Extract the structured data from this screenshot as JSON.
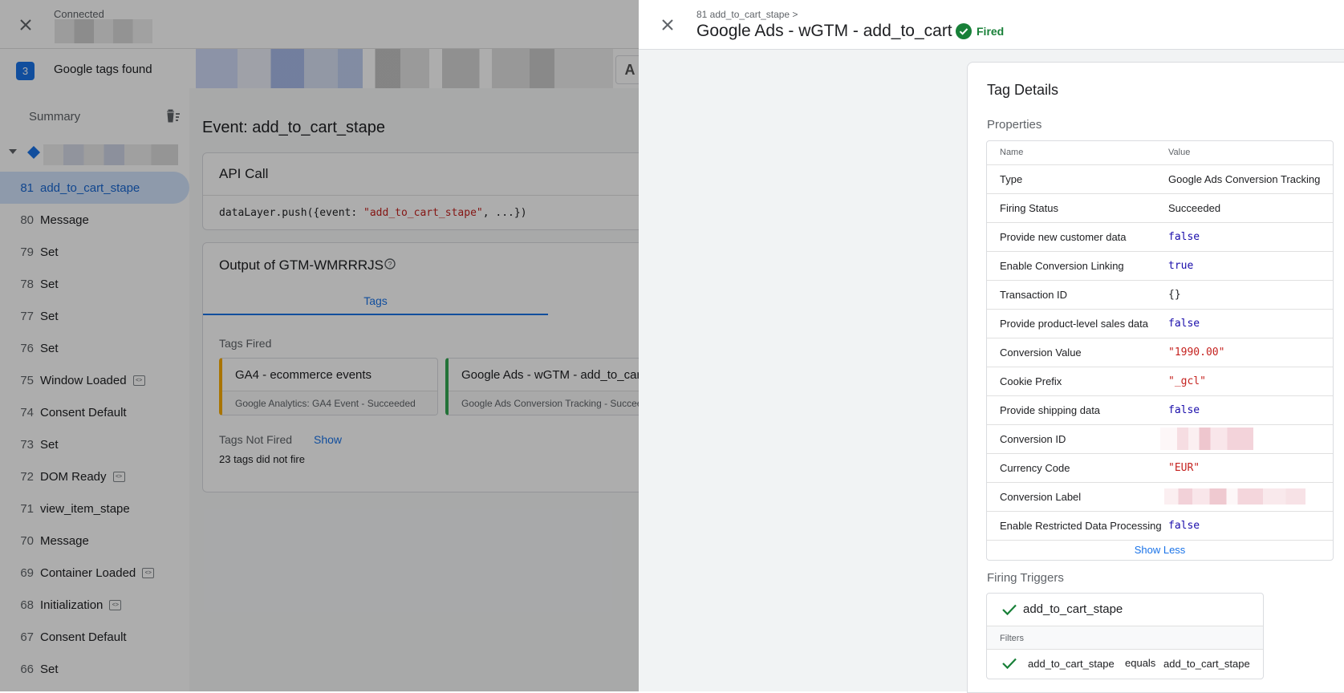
{
  "app": {
    "status": "Connected",
    "tag_count": "3",
    "tags_found": "Google tags found"
  },
  "sidebar": {
    "summary": "Summary",
    "events": [
      {
        "num": "81",
        "label": "add_to_cart_stape"
      },
      {
        "num": "80",
        "label": "Message"
      },
      {
        "num": "79",
        "label": "Set"
      },
      {
        "num": "78",
        "label": "Set"
      },
      {
        "num": "77",
        "label": "Set"
      },
      {
        "num": "76",
        "label": "Set"
      },
      {
        "num": "75",
        "label": "Window Loaded"
      },
      {
        "num": "74",
        "label": "Consent Default"
      },
      {
        "num": "73",
        "label": "Set"
      },
      {
        "num": "72",
        "label": "DOM Ready"
      },
      {
        "num": "71",
        "label": "view_item_stape"
      },
      {
        "num": "70",
        "label": "Message"
      },
      {
        "num": "69",
        "label": "Container Loaded"
      },
      {
        "num": "68",
        "label": "Initialization"
      },
      {
        "num": "67",
        "label": "Consent Default"
      },
      {
        "num": "66",
        "label": "Set"
      }
    ]
  },
  "main": {
    "event_title": "Event: add_to_cart_stape",
    "api_call": {
      "title": "API Call",
      "code_prefix": "dataLayer.push({event: ",
      "code_event": "\"add_to_cart_stape\"",
      "code_suffix": ", ...})"
    },
    "output": {
      "title": "Output of GTM-WMRRRJS",
      "tab": "Tags",
      "tags_fired": "Tags Fired",
      "fired": [
        {
          "name": "GA4 - ecommerce events",
          "sub": "Google Analytics: GA4 Event - Succeeded"
        },
        {
          "name": "Google Ads - wGTM - add_to_cart",
          "sub": "Google Ads Conversion Tracking - Succeeded"
        }
      ],
      "not_fired_label": "Tags Not Fired",
      "show": "Show",
      "not_fired_count": "23 tags did not fire"
    }
  },
  "panel": {
    "breadcrumb": "81 add_to_cart_stape >",
    "title": "Google Ads - wGTM - add_to_cart",
    "status": "Fired",
    "details_title": "Tag Details",
    "properties_label": "Properties",
    "table_head": {
      "name": "Name",
      "value": "Value"
    },
    "properties": [
      {
        "name": "Type",
        "value": "Google Ads Conversion Tracking",
        "kind": "text"
      },
      {
        "name": "Firing Status",
        "value": "Succeeded",
        "kind": "text"
      },
      {
        "name": "Provide new customer data",
        "value": "false",
        "kind": "bool"
      },
      {
        "name": "Enable Conversion Linking",
        "value": "true",
        "kind": "bool"
      },
      {
        "name": "Transaction ID",
        "value": "{}",
        "kind": "obj"
      },
      {
        "name": "Provide product-level sales data",
        "value": "false",
        "kind": "bool"
      },
      {
        "name": "Conversion Value",
        "value": "\"1990.00\"",
        "kind": "str"
      },
      {
        "name": "Cookie Prefix",
        "value": "\"_gcl\"",
        "kind": "str"
      },
      {
        "name": "Provide shipping data",
        "value": "false",
        "kind": "bool"
      },
      {
        "name": "Conversion ID",
        "value": "",
        "kind": "redacted"
      },
      {
        "name": "Currency Code",
        "value": "\"EUR\"",
        "kind": "str"
      },
      {
        "name": "Conversion Label",
        "value": "",
        "kind": "redacted-wide"
      },
      {
        "name": "Enable Restricted Data Processing",
        "value": "false",
        "kind": "bool"
      }
    ],
    "show_less": "Show Less",
    "firing_triggers_label": "Firing Triggers",
    "trigger": {
      "name": "add_to_cart_stape",
      "filters_label": "Filters",
      "filter_variable": "add_to_cart_stape",
      "filter_operator": "equals",
      "filter_value": "add_to_cart_stape"
    }
  },
  "colors": {
    "accent": "#1a73e8",
    "fired_green": "#188038",
    "string_red": "#c5221f",
    "boolean_blue": "#1a0dab",
    "ga4_orange": "#f9ab00"
  }
}
